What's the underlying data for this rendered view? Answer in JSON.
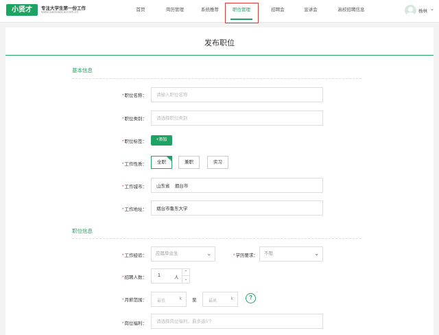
{
  "header": {
    "logo_text": "小贤才",
    "slogan": "专注大学生第一份工作",
    "domain": "www.xiaoxiancai.com.cn",
    "nav": [
      "首页",
      "简历管理",
      "系统推荐",
      "职位管理",
      "招聘会",
      "宣讲会",
      "高校招聘信息"
    ],
    "active_nav": "职位管理",
    "user_name": "杨林",
    "user_caret": "⌄",
    "accent_color": "#1da462",
    "highlight_color": "#e53935"
  },
  "page": {
    "title": "发布职位"
  },
  "basic_info": {
    "section_title": "基本信息",
    "required_mark": "*",
    "name": {
      "label": "职位名称：",
      "placeholder": "请输入职位名称"
    },
    "category": {
      "label": "职位类别：",
      "placeholder": "请选择职位类别"
    },
    "tags": {
      "label": "职位标签：",
      "add_button": "+添加"
    },
    "nature": {
      "label": "工作性质：",
      "options": [
        "全职",
        "兼职",
        "实习"
      ],
      "selected": "全职"
    },
    "city": {
      "label": "工作城市：",
      "value": "山东省    烟台市"
    },
    "address": {
      "label": "工作地址：",
      "value": "烟台市鲁东大学"
    }
  },
  "job_info": {
    "section_title": "职位信息",
    "experience": {
      "label": "工作经验：",
      "value": "应届毕业生"
    },
    "education": {
      "label": "学历要求：",
      "value": "不限"
    },
    "headcount": {
      "label": "招聘人数：",
      "value": "1",
      "unit": "人",
      "up": "⌃",
      "down": "⌄"
    },
    "salary": {
      "label": "月薪范围：",
      "min_placeholder": "最低",
      "max_placeholder": "最高",
      "unit": "k",
      "to": "至",
      "help": "?"
    },
    "benefits": {
      "label": "岗位福利：",
      "placeholder": "请选择岗位福利，最多选5个"
    }
  },
  "icons": {
    "caret_down": "⌄",
    "check_mark": "✓"
  }
}
